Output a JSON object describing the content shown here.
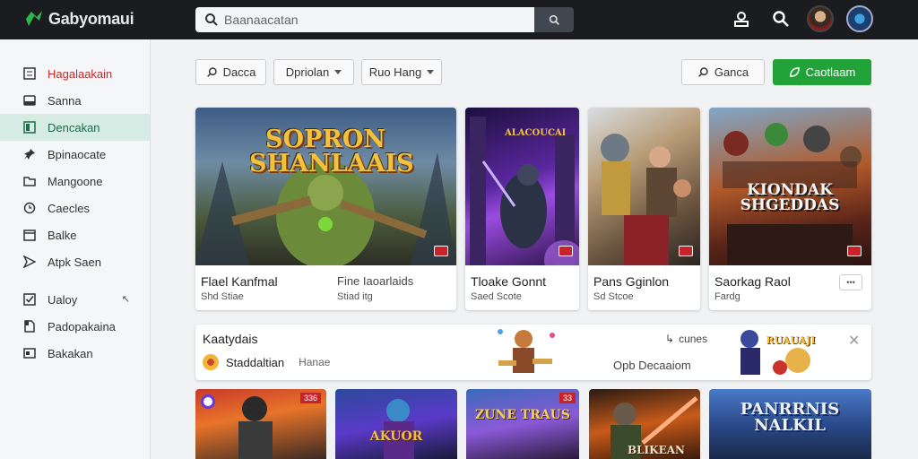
{
  "app": {
    "logo_text": "Gabyomaui"
  },
  "search": {
    "placeholder": "Baanaacatan"
  },
  "sidebar": {
    "items": [
      {
        "label": "Hagalaakain",
        "icon": "list-icon"
      },
      {
        "label": "Sanna",
        "icon": "inbox-icon"
      },
      {
        "label": "Dencakan",
        "icon": "book-icon"
      },
      {
        "label": "Bpinaocate",
        "icon": "pin-icon"
      },
      {
        "label": "Mangoone",
        "icon": "folder-icon"
      },
      {
        "label": "Caecles",
        "icon": "clock-icon"
      },
      {
        "label": "Balke",
        "icon": "calendar-icon"
      },
      {
        "label": "Atpk Saen",
        "icon": "send-icon"
      },
      {
        "label": "Ualoy",
        "icon": "check-box-icon"
      },
      {
        "label": "Padopakaina",
        "icon": "document-icon"
      },
      {
        "label": "Bakakan",
        "icon": "window-icon"
      }
    ]
  },
  "toolbar": {
    "btn1": "Dacca",
    "btn2": "Dpriolan",
    "btn3": "Ruo Hang",
    "btn4": "Ganca",
    "btn_green": "Caotlaam"
  },
  "cards": [
    {
      "art_title": "SOPRON SHANLAAIS",
      "title": "Flael Kanfmal",
      "sub": "Shd Stiae",
      "extra_title": "Fine Iaoarlaids",
      "extra_sub": "Stiad itg"
    },
    {
      "art_title": "ALACOUCAI",
      "title": "Tloake Gonnt",
      "sub": "Saed Scote"
    },
    {
      "art_title": "",
      "title": "Pans Gginlon",
      "sub": "Sd Stcoe"
    },
    {
      "art_title": "KIONDAK SHGEDDAS",
      "title": "Saorkag Raol",
      "sub": "Fardg",
      "more": "•••"
    }
  ],
  "banner": {
    "title": "Kaatydais",
    "item_label": "Staddaltian",
    "item_sub": "Hanae",
    "right_label": "cunes",
    "center_text": "Opb Decaaiom",
    "art_title": "RUAUAJI"
  },
  "bottom": [
    {
      "art_title": "",
      "badge": "336"
    },
    {
      "art_title": "AKUOR"
    },
    {
      "art_title": "ZUNE TRAUS",
      "badge": "33"
    },
    {
      "art_title": "BLIKEAN"
    },
    {
      "art_title": "PANRRNIS NALKIL"
    }
  ],
  "colors": {
    "accent": "#21a33a",
    "active_bg": "#d6ebe3",
    "brand_red": "#c8292c"
  }
}
